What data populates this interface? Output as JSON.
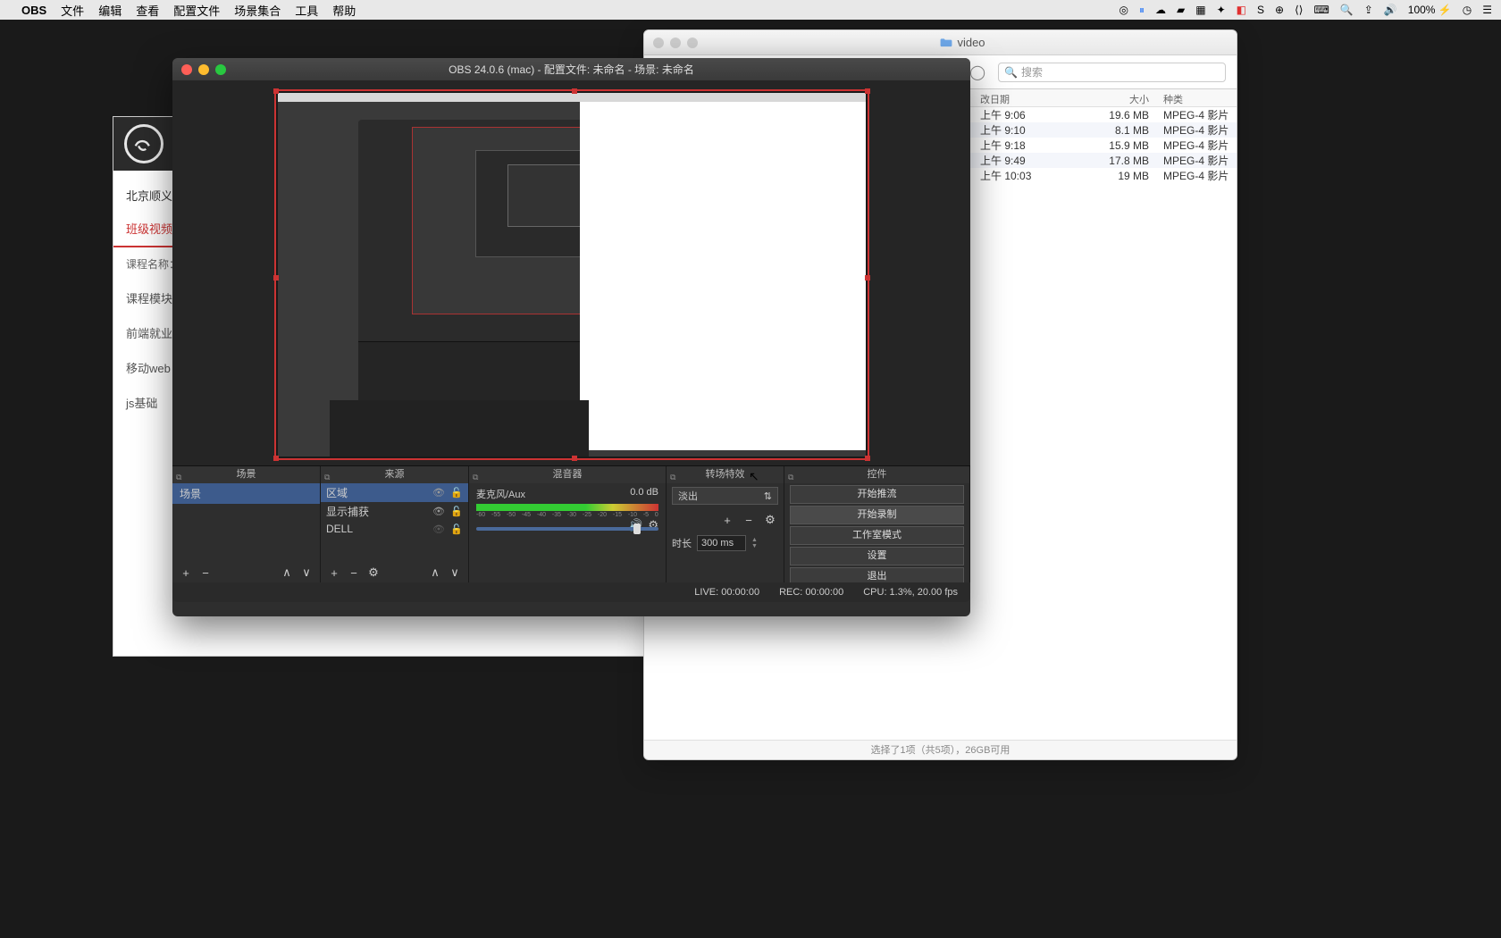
{
  "menubar": {
    "app": "OBS",
    "items": [
      "文件",
      "编辑",
      "查看",
      "配置文件",
      "场景集合",
      "工具",
      "帮助"
    ],
    "battery": "100%",
    "clock_icon": "◷",
    "extras": "☰"
  },
  "finder": {
    "title": "video",
    "search_placeholder": "搜索",
    "columns": {
      "date": "改日期",
      "size": "大小",
      "kind": "种类"
    },
    "rows": [
      {
        "date": "上午 9:06",
        "size": "19.6 MB",
        "kind": "MPEG-4 影片"
      },
      {
        "date": "上午 9:10",
        "size": "8.1 MB",
        "kind": "MPEG-4 影片"
      },
      {
        "date": "上午 9:18",
        "size": "15.9 MB",
        "kind": "MPEG-4 影片"
      },
      {
        "date": "上午 9:49",
        "size": "17.8 MB",
        "kind": "MPEG-4 影片"
      },
      {
        "date": "上午 10:03",
        "size": "19 MB",
        "kind": "MPEG-4 影片"
      }
    ],
    "status": "选择了1项（共5项），26GB可用"
  },
  "browser": {
    "heading": "北京顺义区",
    "active_tab": "班级视频",
    "course_label": "课程名称：",
    "items": [
      "课程模块",
      "前端就业",
      "移动web",
      "js基础"
    ]
  },
  "obs": {
    "title": "OBS 24.0.6 (mac) - 配置文件: 未命名 - 场景: 未命名",
    "panels": {
      "scenes": {
        "title": "场景",
        "items": [
          "场景"
        ]
      },
      "sources": {
        "title": "来源",
        "items": [
          "区域",
          "显示捕获",
          "DELL"
        ]
      },
      "mixer": {
        "title": "混音器",
        "track": "麦克风/Aux",
        "level": "0.0 dB",
        "ticks": [
          "-60",
          "-55",
          "-50",
          "-45",
          "-40",
          "-35",
          "-30",
          "-25",
          "-20",
          "-15",
          "-10",
          "-5",
          "0"
        ]
      },
      "transitions": {
        "title": "转场特效",
        "mode": "淡出",
        "duration_label": "时长",
        "duration": "300 ms"
      },
      "controls": {
        "title": "控件",
        "buttons": [
          "开始推流",
          "开始录制",
          "工作室模式",
          "设置",
          "退出"
        ]
      }
    },
    "status": {
      "live": "LIVE: 00:00:00",
      "rec": "REC: 00:00:00",
      "cpu": "CPU: 1.3%, 20.00 fps"
    }
  }
}
